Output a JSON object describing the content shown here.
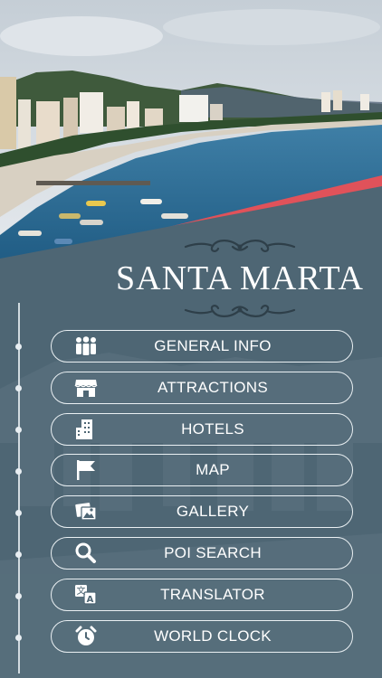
{
  "app": {
    "title": "SANTA MARTA"
  },
  "menu": [
    {
      "label": "GENERAL INFO",
      "icon": "people-group-icon"
    },
    {
      "label": "ATTRACTIONS",
      "icon": "storefront-icon"
    },
    {
      "label": "HOTELS",
      "icon": "hotel-building-icon"
    },
    {
      "label": "MAP",
      "icon": "flag-icon"
    },
    {
      "label": "GALLERY",
      "icon": "photo-gallery-icon"
    },
    {
      "label": "POI SEARCH",
      "icon": "magnifier-icon"
    },
    {
      "label": "TRANSLATOR",
      "icon": "translate-icon"
    },
    {
      "label": "WORLD CLOCK",
      "icon": "alarm-clock-icon"
    }
  ],
  "colors": {
    "panel": "#4e6674",
    "accent_stripe": "#e0525a",
    "text": "#ffffff"
  }
}
